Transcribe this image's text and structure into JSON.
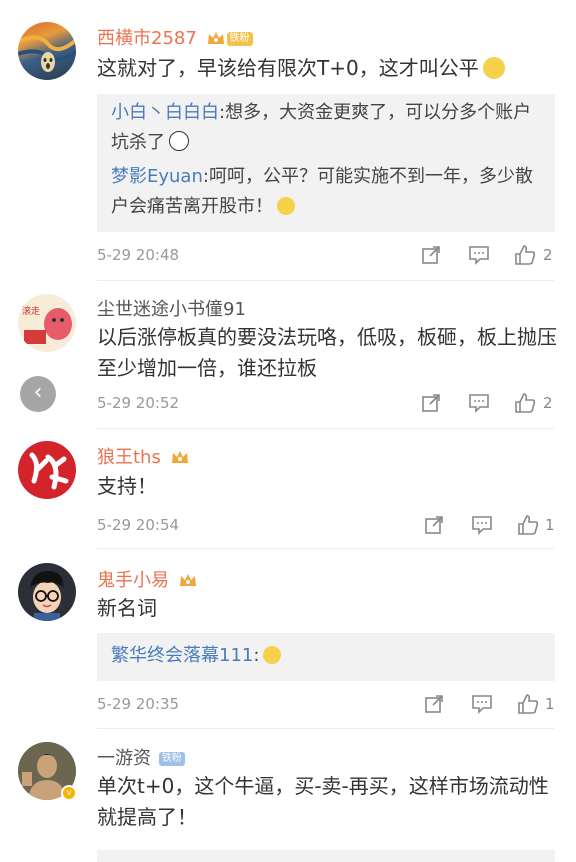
{
  "comments": [
    {
      "username": "西横市2587",
      "badge": "铁粉",
      "text": "这就对了，早该给有限次T+0，这才叫公平",
      "replies": [
        {
          "user": "小白丶白白白",
          "text": ":想多，大资金更爽了，可以分多个账户坑杀了"
        },
        {
          "user": "梦影Eyuan",
          "text": ":呵呵，公平？可能实施不到一年，多少散户会痛苦离开股市！"
        }
      ],
      "time": "5-29 20:48",
      "likes": "2"
    },
    {
      "username": "尘世迷途小书僮91",
      "text": "以后涨停板真的要没法玩咯，低吸，板砸，板上抛压至少增加一倍，谁还拉板",
      "time": "5-29 20:52",
      "likes": "2"
    },
    {
      "username": "狼王ths",
      "text": "支持！",
      "time": "5-29 20:54",
      "likes": "1"
    },
    {
      "username": "鬼手小易",
      "text": "新名词",
      "replies": [
        {
          "user": "繁华终会落幕111",
          "text": ":"
        }
      ],
      "time": "5-29 20:35",
      "likes": "1"
    },
    {
      "username": "一游资",
      "badge": "铁粉",
      "text": "单次t+0，这个牛逼，买-卖-再买，这样市场流动性就提高了！"
    }
  ],
  "icons": {
    "share": "share-icon",
    "comment": "comment-icon",
    "like": "like-icon",
    "back": "back-arrow-icon"
  },
  "colors": {
    "name_orange": "#eb7350",
    "reply_blue": "#4a7cbb",
    "badge_gold": "#f3c24d"
  }
}
